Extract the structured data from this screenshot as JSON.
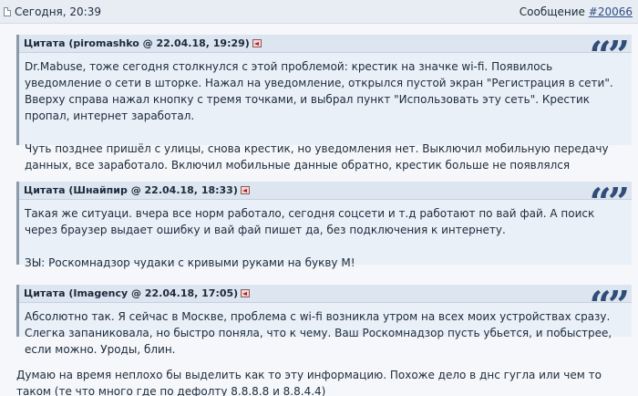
{
  "post": {
    "date": "Сегодня, 20:39",
    "message_label": "Сообщение",
    "message_number": "#20066",
    "text": "Думаю на время неплохо бы выделить как то эту информацию. Похоже дело в днс гугла или чем то таком (те что много где по дефолту 8.8.8.8 и 8.8.4.4)"
  },
  "quotes": [
    {
      "header": "Цитата (piromashko @ 22.04.18, 19:29",
      "paragraphs": [
        "Dr.Mabuse, тоже сегодня столкнулся с этой проблемой: крестик на значке wi-fi. Появилось уведомление о сети в шторке. Нажал на уведомление, открылся пустой экран \"Регистрация в сети\". Вверху справа нажал кнопку с тремя точками, и выбрал пункт \"Использовать эту сеть\". Крестик пропал, интернет заработал.",
        "Чуть позднее пришёл с улицы, снова крестик, но уведомления нет. Выключил мобильную передачу данных, все заработало. Включил мобильные данные обратно, крестик больше не появлялся"
      ]
    },
    {
      "header": "Цитата (Шнайпир @ 22.04.18, 18:33",
      "paragraphs": [
        "Такая же ситуаци. вчера все норм работало, сегодня соцсети и т.д работают по вай фай. А поиск через браузер выдает ошибку и вай фай пишет да, без подключения к интернету.",
        "ЗЫ: Роскомнадзор чудаки с кривыми руками на букву М!"
      ]
    },
    {
      "header": "Цитата (Imagency @ 22.04.18, 17:05",
      "paragraphs": [
        "Абсолютно так. Я сейчас в Москве, проблема с wi-fi возникла утром на всех моих устройствах сразу. Слегка запаниковала, но быстро поняла, что к чему. Ваш Роскомнадзор пусть убьется, и побыстрее, если можно. Уроды, блин."
      ]
    }
  ],
  "quote_mark": "“”",
  "colors": {
    "header_bg": "#e8edf4",
    "quote_bg": "#eaf0f8",
    "quote_head_bg": "#dde5f0",
    "quote_mark": "#2f4d78",
    "link": "#2a4f86"
  }
}
